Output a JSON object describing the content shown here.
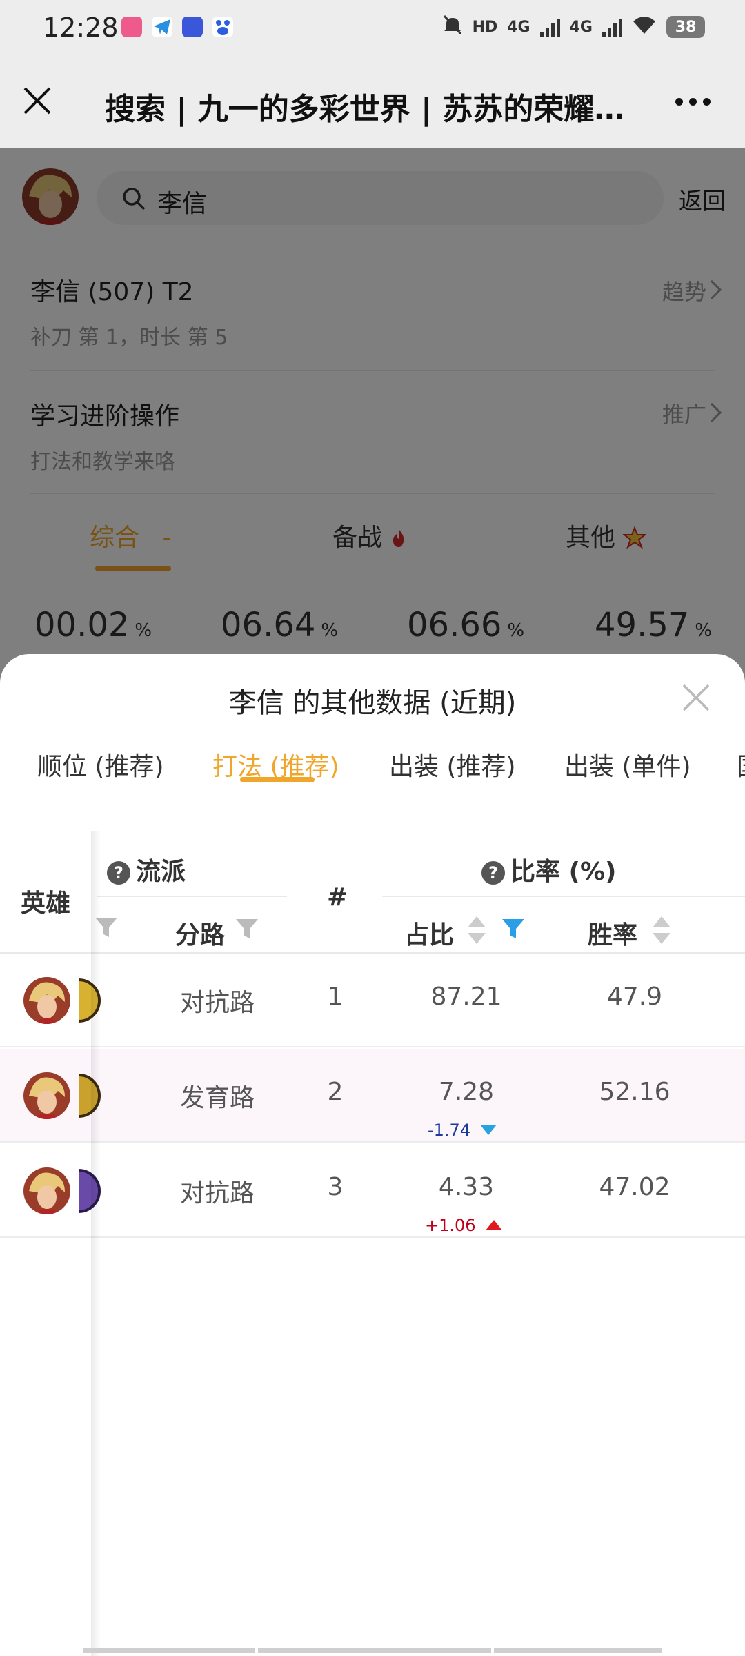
{
  "status_bar": {
    "time": "12:28",
    "battery": "38",
    "network_labels": [
      "HD",
      "4G",
      "4G"
    ],
    "icons": [
      "bilibili-app-icon",
      "telegram-app-icon",
      "tieba-app-icon",
      "baidu-app-icon",
      "mute-bell-icon",
      "wifi-icon",
      "battery-icon"
    ]
  },
  "title_bar": {
    "title": "搜索 | 九一的多彩世界 | 苏苏的荣耀…"
  },
  "background_page": {
    "search": {
      "query": "李信",
      "back_label": "返回"
    },
    "hero_row": {
      "title": "李信 (507) T2",
      "subtitle": "补刀 第 1，时长 第 5",
      "action": "趋势"
    },
    "learn_row": {
      "title": "学习进阶操作",
      "subtitle": "打法和教学来咯",
      "action": "推广"
    },
    "tabs": [
      {
        "label": "综合",
        "suffix": "-"
      },
      {
        "label": "备战"
      },
      {
        "label": "其他"
      }
    ],
    "stats": [
      {
        "value": "00.02",
        "unit": "%"
      },
      {
        "value": "06.64",
        "unit": "%"
      },
      {
        "value": "06.66",
        "unit": "%"
      },
      {
        "value": "49.57",
        "unit": "%"
      }
    ]
  },
  "sheet": {
    "title": "李信 的其他数据 (近期)",
    "tabs": [
      "顺位 (推荐)",
      "打法 (推荐)",
      "出装 (推荐)",
      "出装 (单件)",
      "国"
    ],
    "active_tab_index": 1,
    "table": {
      "headers": {
        "hero": "英雄",
        "school_group": "流派",
        "lane": "分路",
        "rank": "#",
        "rate_group": "比率 (%)",
        "share": "占比",
        "winrate": "胜率"
      },
      "rows": [
        {
          "lane": "对抗路",
          "rank": "1",
          "share": "87.21",
          "winrate": "47.9",
          "delta": ""
        },
        {
          "lane": "发育路",
          "rank": "2",
          "share": "7.28",
          "winrate": "52.16",
          "delta": "-1.74",
          "delta_dir": "down"
        },
        {
          "lane": "对抗路",
          "rank": "3",
          "share": "4.33",
          "winrate": "47.02",
          "delta": "+1.06",
          "delta_dir": "up"
        }
      ]
    }
  },
  "colors": {
    "accent": "#f0a62a",
    "filter_active": "#2a9fe6",
    "delta_down": "#1a3a9c",
    "delta_up": "#c0001a"
  }
}
